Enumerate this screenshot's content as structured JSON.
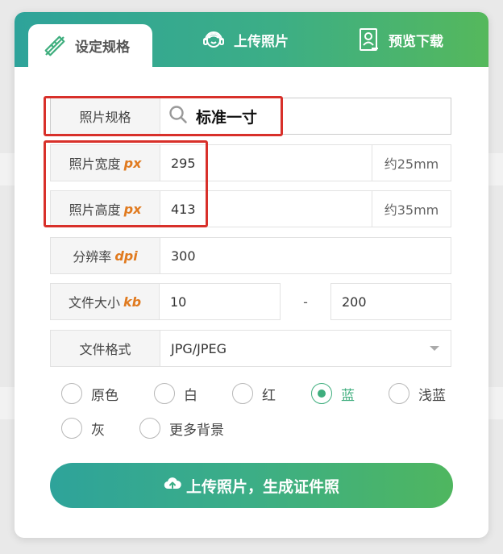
{
  "tabs": [
    {
      "label": "设定规格",
      "icon": "ruler-pencil-icon",
      "active": true
    },
    {
      "label": "上传照片",
      "icon": "headset-avatar-icon",
      "active": false
    },
    {
      "label": "预览下载",
      "icon": "id-photo-icon",
      "active": false
    }
  ],
  "spec": {
    "label": "照片规格",
    "value": "标准一寸",
    "icon": "search-icon"
  },
  "width": {
    "label": "照片宽度",
    "unit": "px",
    "value": "295",
    "approx": "约25mm"
  },
  "height": {
    "label": "照片高度",
    "unit": "px",
    "value": "413",
    "approx": "约35mm"
  },
  "resolution": {
    "label": "分辨率",
    "unit": "dpi",
    "value": "300"
  },
  "file_size": {
    "label": "文件大小",
    "unit": "kb",
    "min": "10",
    "separator": "-",
    "max": "200"
  },
  "file_format": {
    "label": "文件格式",
    "value": "JPG/JPEG",
    "icon": "caret-down-icon"
  },
  "backgrounds": [
    {
      "label": "原色",
      "checked": false
    },
    {
      "label": "白",
      "checked": false
    },
    {
      "label": "红",
      "checked": false
    },
    {
      "label": "蓝",
      "checked": true
    },
    {
      "label": "浅蓝",
      "checked": false
    },
    {
      "label": "灰",
      "checked": false
    },
    {
      "label": "更多背景",
      "checked": false
    }
  ],
  "submit": {
    "label": "上传照片，生成证件照",
    "icon": "cloud-upload-icon"
  },
  "colors": {
    "accent": "#3fae7e",
    "unit": "#e07a1f",
    "highlight": "#d8302a"
  }
}
